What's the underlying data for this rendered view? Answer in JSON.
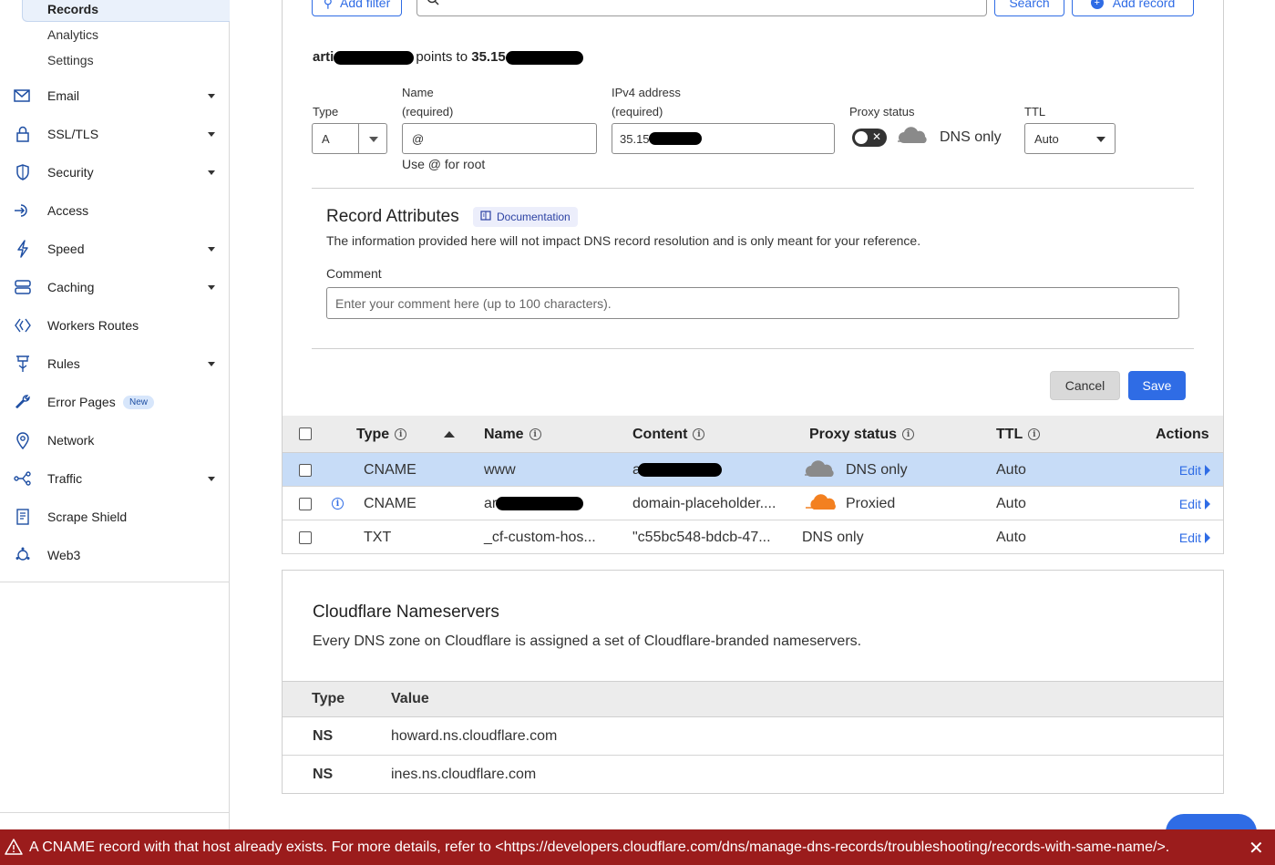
{
  "sidebar": {
    "subitems": {
      "records": "Records",
      "analytics": "Analytics",
      "settings": "Settings"
    },
    "items": [
      {
        "label": "Email",
        "icon": "envelope-icon",
        "caret": true
      },
      {
        "label": "SSL/TLS",
        "icon": "lock-icon",
        "caret": true
      },
      {
        "label": "Security",
        "icon": "shield-icon",
        "caret": true
      },
      {
        "label": "Access",
        "icon": "access-icon",
        "caret": false
      },
      {
        "label": "Speed",
        "icon": "lightning-icon",
        "caret": true
      },
      {
        "label": "Caching",
        "icon": "server-icon",
        "caret": true
      },
      {
        "label": "Workers Routes",
        "icon": "workers-icon",
        "caret": false
      },
      {
        "label": "Rules",
        "icon": "rules-icon",
        "caret": true
      },
      {
        "label": "Error Pages",
        "icon": "wrench-icon",
        "caret": false,
        "badge": "New"
      },
      {
        "label": "Network",
        "icon": "location-pin-icon",
        "caret": false
      },
      {
        "label": "Traffic",
        "icon": "traffic-icon",
        "caret": true
      },
      {
        "label": "Scrape Shield",
        "icon": "document-icon",
        "caret": false
      },
      {
        "label": "Web3",
        "icon": "web3-icon",
        "caret": false
      }
    ]
  },
  "toolbar": {
    "add_filter": "Add filter",
    "search": "Search",
    "add_record": "Add record"
  },
  "form": {
    "points_prefix": "arti",
    "points_to": "points to",
    "points_value": "35.15",
    "type_label": "Type",
    "type_value": "A",
    "name_label": "Name",
    "name_required": "(required)",
    "name_value": "@",
    "name_hint": "Use @ for root",
    "ipv4_label": "IPv4 address",
    "ipv4_required": "(required)",
    "ipv4_value": "35.158",
    "proxy_label": "Proxy status",
    "proxy_value": "DNS only",
    "ttl_label": "TTL",
    "ttl_value": "Auto"
  },
  "attributes": {
    "title": "Record Attributes",
    "doc_label": "Documentation",
    "description": "The information provided here will not impact DNS record resolution and is only meant for your reference.",
    "comment_label": "Comment",
    "comment_placeholder": "Enter your comment here (up to 100 characters)."
  },
  "buttons": {
    "cancel": "Cancel",
    "save": "Save"
  },
  "table": {
    "headers": {
      "type": "Type",
      "name": "Name",
      "content": "Content",
      "proxy": "Proxy status",
      "ttl": "TTL",
      "actions": "Actions"
    },
    "rows": [
      {
        "type": "CNAME",
        "name": "www",
        "content": "ar",
        "proxy": "DNS only",
        "ttl": "Auto",
        "action": "Edit"
      },
      {
        "type": "CNAME",
        "name": "art",
        "content": "domain-placeholder....",
        "proxy": "Proxied",
        "ttl": "Auto",
        "action": "Edit"
      },
      {
        "type": "TXT",
        "name": "_cf-custom-hos...",
        "content": "\"c55bc548-bdcb-47...",
        "proxy": "DNS only",
        "ttl": "Auto",
        "action": "Edit"
      }
    ]
  },
  "nameservers": {
    "title": "Cloudflare Nameservers",
    "description": "Every DNS zone on Cloudflare is assigned a set of Cloudflare-branded nameservers.",
    "header_type": "Type",
    "header_value": "Value",
    "rows": [
      {
        "type": "NS",
        "value": "howard.ns.cloudflare.com"
      },
      {
        "type": "NS",
        "value": "ines.ns.cloudflare.com"
      }
    ]
  },
  "error": {
    "message": "A CNAME record with that host already exists. For more details, refer to <https://developers.cloudflare.com/dns/manage-dns-records/troubleshooting/records-with-same-name/>."
  },
  "colors": {
    "accent": "#2f6ce5",
    "error_bg": "#9b1c1c",
    "selected_row": "#c7dcf7",
    "proxied_orange": "#f38020"
  }
}
